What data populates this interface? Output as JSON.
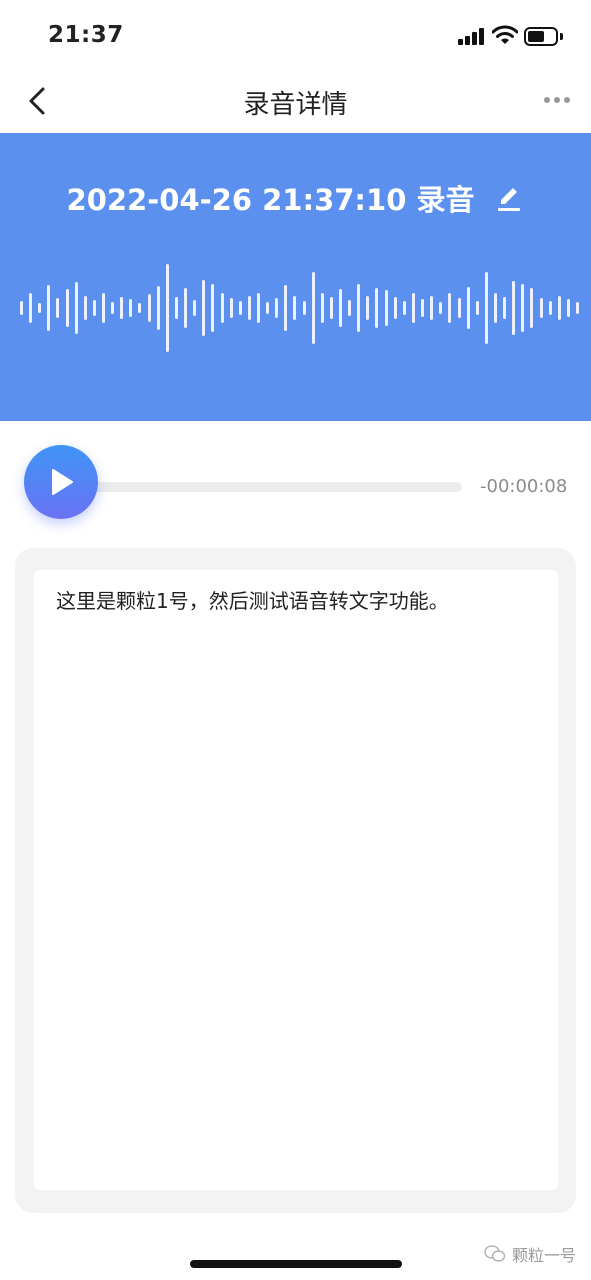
{
  "status_bar": {
    "time": "21:37",
    "icons": [
      "signal-icon",
      "wifi-icon",
      "battery-icon"
    ],
    "battery_level": 0.6
  },
  "nav": {
    "title": "录音详情",
    "back_icon": "back-chevron-icon",
    "more_icon": "more-dots-icon"
  },
  "recording": {
    "title": "2022-04-26 21:37:10 录音",
    "edit_icon": "edit-pencil-icon",
    "accent_color": "#5b90ee"
  },
  "player": {
    "play_icon": "play-icon",
    "progress": 0,
    "time_remaining": "-00:00:08"
  },
  "transcript": {
    "text": "这里是颗粒1号，然后测试语音转文字功能。"
  },
  "watermark": {
    "text": "颗粒一号",
    "icon": "wechat-icon"
  }
}
